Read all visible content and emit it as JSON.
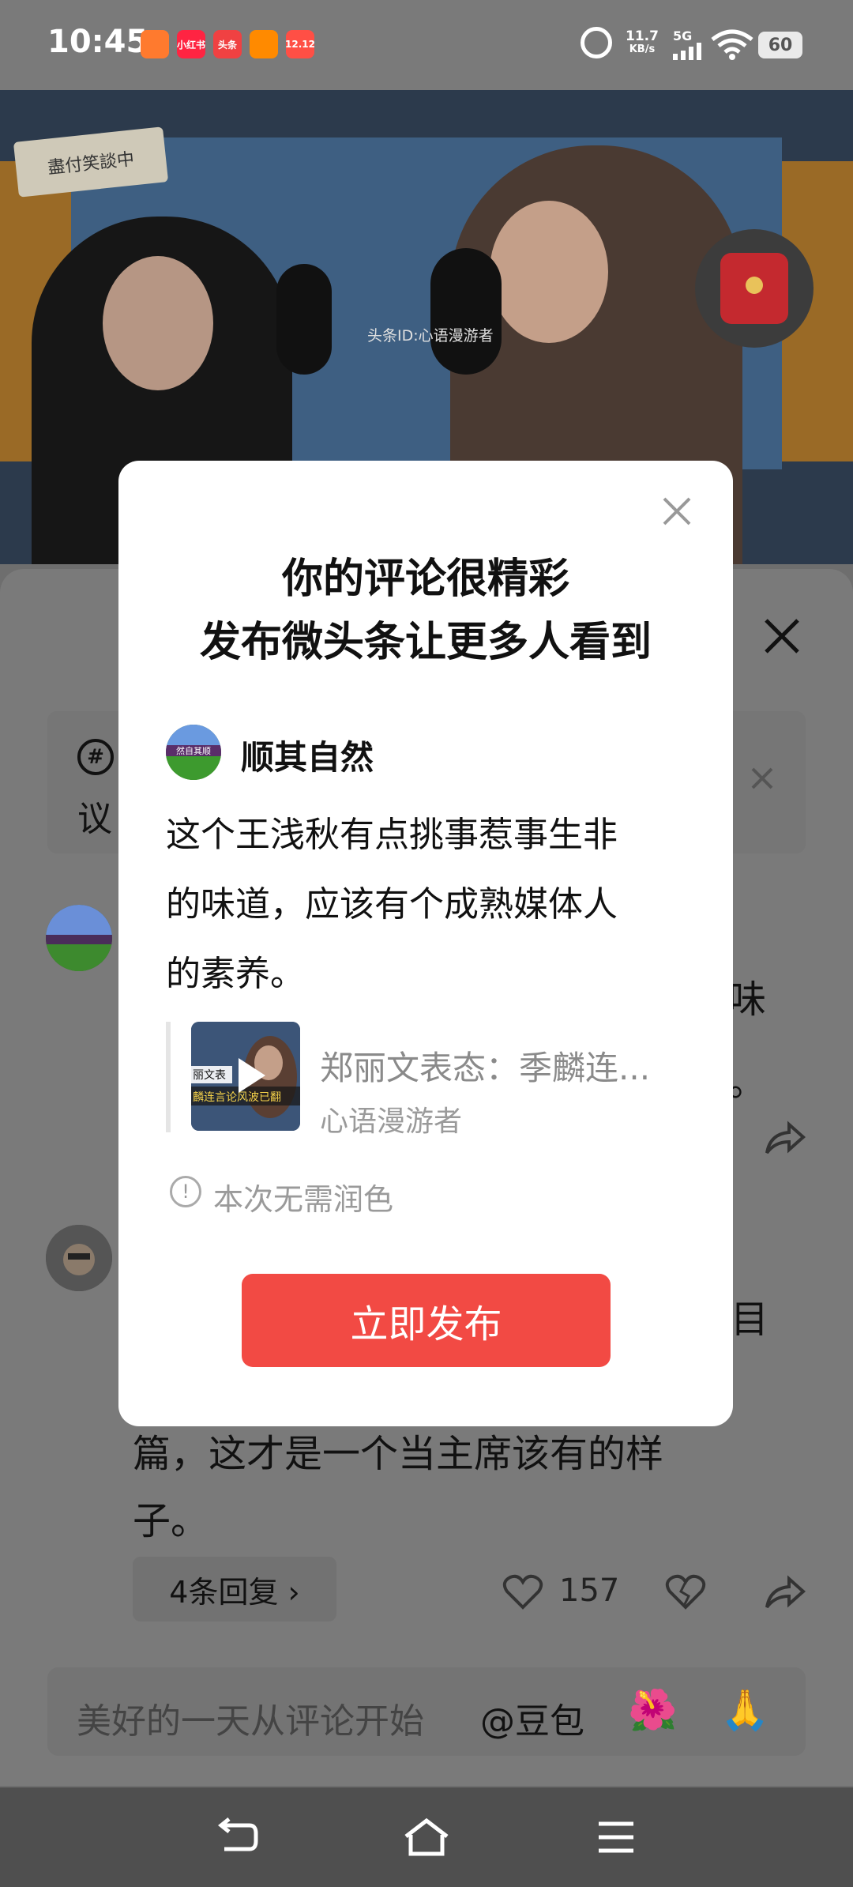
{
  "status_bar": {
    "time": "10:45",
    "app_icons": [
      {
        "name": "kuaishou-icon",
        "label": "",
        "color": "#ff7a2e"
      },
      {
        "name": "xiaohongshu-icon",
        "label": "小红书",
        "color": "#ff2442"
      },
      {
        "name": "toutiao-icon",
        "label": "头条",
        "color": "#f04142"
      },
      {
        "name": "shop-icon",
        "label": "",
        "color": "#ff8a00"
      },
      {
        "name": "event-icon",
        "label": "12.12",
        "color": "#ff4f45"
      }
    ],
    "net_speed_value": "11.7",
    "net_speed_unit": "KB/s",
    "network_type": "5G",
    "battery": "60"
  },
  "video": {
    "watermark": "头条ID:心语漫游者",
    "sign_text": "盡付笑談中"
  },
  "background": {
    "topic_icon": "#",
    "topic_text": "议",
    "comment1_fragments": [
      "味",
      "。"
    ],
    "comment2_fragment": "目",
    "comment2_line1": "篇，这才是一个当主席该有的样",
    "comment2_line2": "子。",
    "replies_label": "4条回复 ›",
    "like_count": "157",
    "input_placeholder": "美好的一天从评论开始",
    "mention": "@豆包",
    "emoji1": "🌺",
    "emoji2": "🙏"
  },
  "modal": {
    "title_line1": "你的评论很精彩",
    "title_line2": "发布微头条让更多人看到",
    "user_avatar_text": "然自其顺",
    "user_name": "顺其自然",
    "comment_line1": "这个王浅秋有点挑事惹事生非",
    "comment_line2": "的味道，应该有个成熟媒体人",
    "comment_line3": "的素养。",
    "quote_title": "郑丽文表态：季麟连...",
    "quote_author": "心语漫游者",
    "thumb_caption1": "丽文表",
    "thumb_caption2": "麟连言论风波已翻",
    "info_text": "本次无需润色",
    "publish_label": "立即发布"
  },
  "colors": {
    "accent": "#f24a44",
    "overlay": "#7a7a7a"
  }
}
